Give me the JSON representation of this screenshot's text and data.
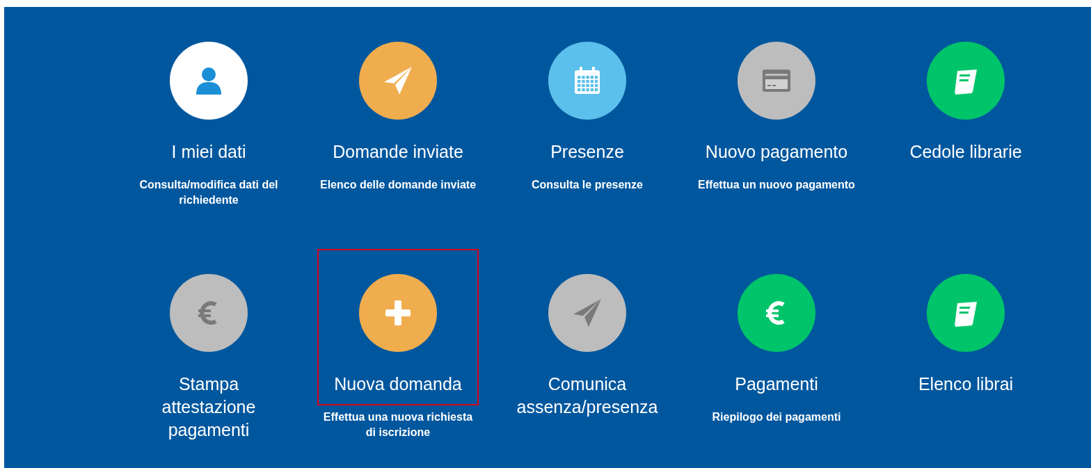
{
  "tiles": [
    {
      "title": "I miei dati",
      "description": "Consulta/modifica dati del richiedente",
      "kind": "user",
      "color": "#ffffff",
      "disabled": false,
      "highlighted": false
    },
    {
      "title": "Domande inviate",
      "description": "Elenco delle domande inviate",
      "kind": "plane",
      "color": "#f0ad4e",
      "disabled": false,
      "highlighted": false
    },
    {
      "title": "Presenze",
      "description": "Consulta le presenze",
      "kind": "calendar",
      "color": "#5bc0eb",
      "disabled": false,
      "highlighted": false
    },
    {
      "title": "Nuovo pagamento",
      "description": "Effettua un nuovo pagamento",
      "kind": "card",
      "color": "#bdbdbd",
      "disabled": true,
      "highlighted": false
    },
    {
      "title": "Cedole librarie",
      "kind": "book",
      "color": "#00c46a",
      "disabled": false,
      "highlighted": false
    },
    {
      "title": "Stampa attestazione pagamenti",
      "kind": "euro",
      "color": "#bdbdbd",
      "disabled": true,
      "highlighted": false
    },
    {
      "title": "Nuova domanda",
      "description": "Effettua una nuova richiesta di iscrizione",
      "kind": "plus",
      "color": "#f0ad4e",
      "disabled": false,
      "highlighted": true
    },
    {
      "title": "Comunica assenza/presenza",
      "kind": "plane",
      "color": "#bdbdbd",
      "disabled": true,
      "highlighted": false
    },
    {
      "title": "Pagamenti",
      "description": "Riepilogo dei pagamenti",
      "kind": "euro",
      "color": "#00c46a",
      "disabled": false,
      "highlighted": false
    },
    {
      "title": "Elenco librai",
      "kind": "book",
      "color": "#00c46a",
      "disabled": false,
      "highlighted": false
    }
  ]
}
